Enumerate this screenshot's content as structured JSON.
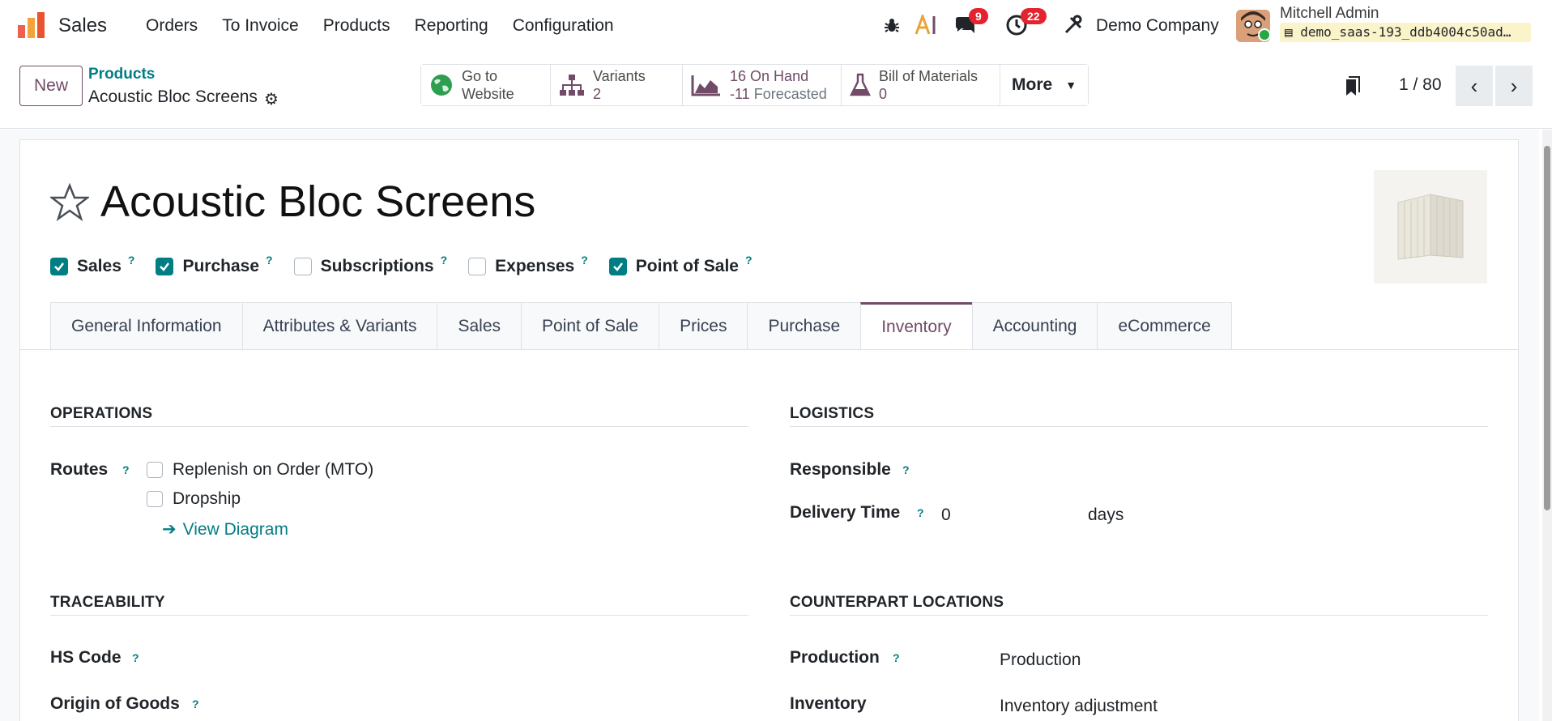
{
  "navbar": {
    "app_name": "Sales",
    "menu": [
      "Orders",
      "To Invoice",
      "Products",
      "Reporting",
      "Configuration"
    ],
    "messages_count": "9",
    "activities_count": "22",
    "company": "Demo Company",
    "user_name": "Mitchell Admin",
    "database": "demo_saas-193_ddb4004c50ad…"
  },
  "control": {
    "new_label": "New",
    "breadcrumb": "Products",
    "record_title": "Acoustic Bloc Screens",
    "smart_buttons": {
      "website_l1": "Go to",
      "website_l2": "Website",
      "variants_label": "Variants",
      "variants_value": "2",
      "onhand_value": "16",
      "onhand_label": "On Hand",
      "forecast_value": "-11",
      "forecast_label": "Forecasted",
      "bom_label": "Bill of Materials",
      "bom_value": "0",
      "more": "More"
    },
    "pager": "1 / 80"
  },
  "form": {
    "product_name": "Acoustic Bloc Screens",
    "flags": [
      {
        "label": "Sales",
        "checked": true
      },
      {
        "label": "Purchase",
        "checked": true
      },
      {
        "label": "Subscriptions",
        "checked": false
      },
      {
        "label": "Expenses",
        "checked": false
      },
      {
        "label": "Point of Sale",
        "checked": true
      }
    ],
    "help_mark": "?",
    "tabs": [
      "General Information",
      "Attributes & Variants",
      "Sales",
      "Point of Sale",
      "Prices",
      "Purchase",
      "Inventory",
      "Accounting",
      "eCommerce"
    ],
    "active_tab": "Inventory",
    "operations": {
      "title": "OPERATIONS",
      "routes_label": "Routes",
      "routes": [
        "Replenish on Order (MTO)",
        "Dropship"
      ],
      "view_diagram": "View Diagram"
    },
    "logistics": {
      "title": "LOGISTICS",
      "responsible_label": "Responsible",
      "delivery_label": "Delivery Time",
      "delivery_value": "0",
      "delivery_unit": "days"
    },
    "traceability": {
      "title": "TRACEABILITY",
      "hs_code_label": "HS Code",
      "origin_label": "Origin of Goods"
    },
    "counterpart": {
      "title": "COUNTERPART LOCATIONS",
      "production_label": "Production",
      "production_value": "Production",
      "inventory_label": "Inventory",
      "inventory_value": "Inventory adjustment"
    }
  },
  "colors": {
    "brand": "#714b67",
    "accent": "#017e84",
    "badge": "#e4232f"
  }
}
